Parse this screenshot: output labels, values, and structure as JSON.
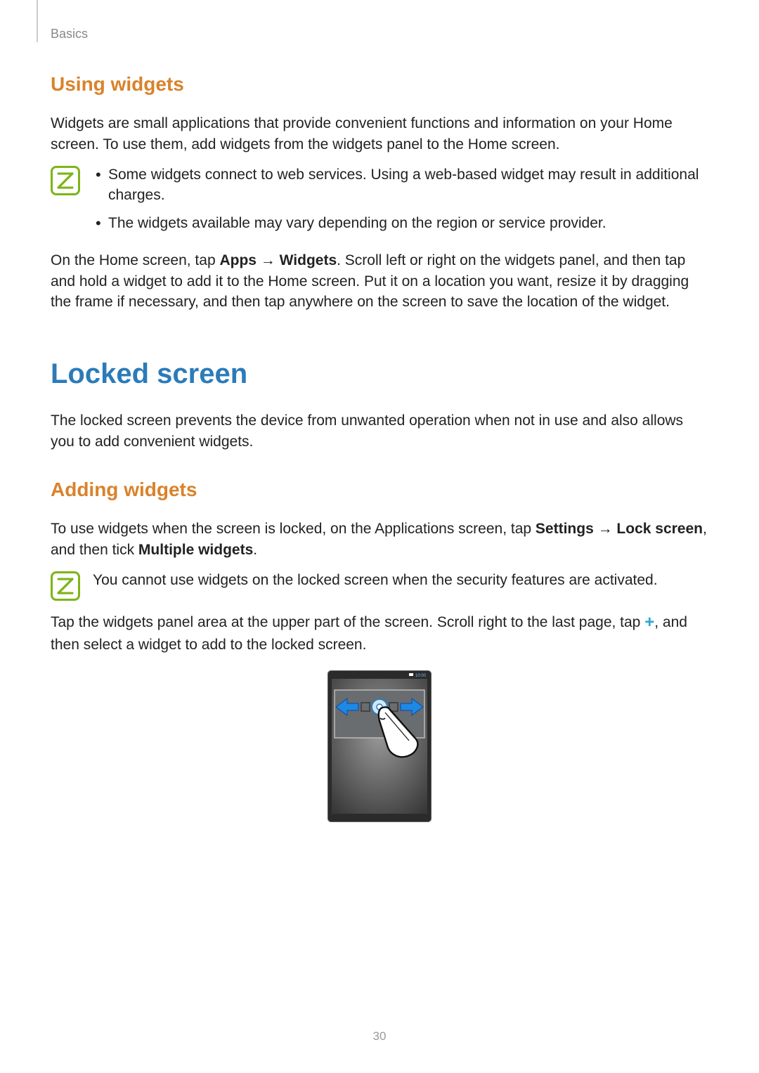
{
  "breadcrumb": "Basics",
  "page_number": "30",
  "using_widgets": {
    "heading": "Using widgets",
    "intro": "Widgets are small applications that provide convenient functions and information on your Home screen. To use them, add widgets from the widgets panel to the Home screen.",
    "notes": [
      "Some widgets connect to web services. Using a web-based widget may result in additional charges.",
      "The widgets available may vary depending on the region or service provider."
    ],
    "instr_pre": "On the Home screen, tap ",
    "instr_apps": "Apps",
    "instr_arrow": " → ",
    "instr_widgets": "Widgets",
    "instr_post": ". Scroll left or right on the widgets panel, and then tap and hold a widget to add it to the Home screen. Put it on a location you want, resize it by dragging the frame if necessary, and then tap anywhere on the screen to save the location of the widget."
  },
  "locked_screen": {
    "heading": "Locked screen",
    "intro": "The locked screen prevents the device from unwanted operation when not in use and also allows you to add convenient widgets."
  },
  "adding_widgets": {
    "heading": "Adding widgets",
    "p1_pre": "To use widgets when the screen is locked, on the Applications screen, tap ",
    "p1_settings": "Settings",
    "p1_arrow": " → ",
    "p1_lockscreen": "Lock screen",
    "p1_mid": ", and then tick ",
    "p1_multiple": "Multiple widgets",
    "p1_post": ".",
    "note": "You cannot use widgets on the locked screen when the security features are activated.",
    "p2_pre": "Tap the widgets panel area at the upper part of the screen. Scroll right to the last page, tap ",
    "p2_post": ", and then select a widget to add to the locked screen.",
    "device_time": "10:00"
  }
}
